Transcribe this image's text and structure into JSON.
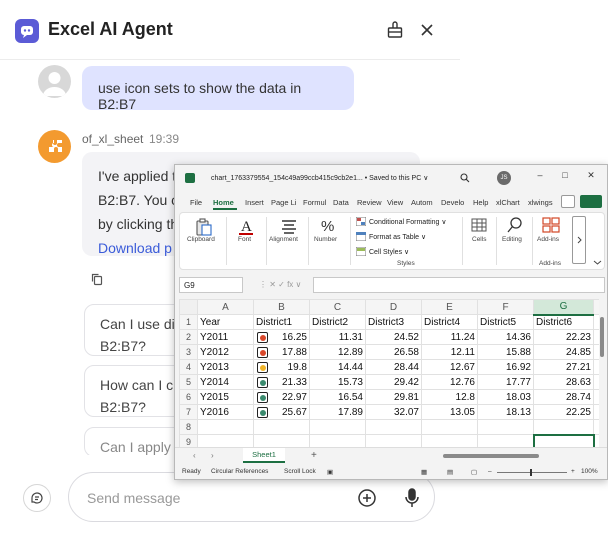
{
  "chat": {
    "header": {
      "title": "Excel AI Agent"
    },
    "user_message": "use icon sets to show the data in B2:B7",
    "bot": {
      "name": "of_xl_sheet",
      "time": "19:39",
      "line1": "I've applied t",
      "line2": "B2:B7. You ca",
      "line3": "by clicking th",
      "link": "Download p"
    },
    "suggestions": [
      {
        "line1": "Can I use dif",
        "line2": "B2:B7?"
      },
      {
        "line1": "How can I cu",
        "line2": "B2:B7?"
      },
      {
        "line1": "Can I apply"
      }
    ],
    "input": {
      "placeholder": "Send message"
    }
  },
  "excel": {
    "title": "chart_1763379554_154c49a99ccb415c9cb2e1...  •  Saved to this PC ∨",
    "user_initials": "JS",
    "window_controls": {
      "minimize": "–",
      "maximize": "□",
      "close": "✕"
    },
    "menu": [
      "File",
      "Home",
      "Insert",
      "Page Li",
      "Formul",
      "Data",
      "Review",
      "View",
      "Autom",
      "Develo",
      "Help",
      "xlChart",
      "xlwings"
    ],
    "active_menu": "Home",
    "ribbon": {
      "clipboard": "Clipboard",
      "font": "Font",
      "alignment": "Alignment",
      "number": "Number",
      "conditional_formatting": "Conditional Formatting ∨",
      "format_as_table": "Format as Table ∨",
      "cell_styles": "Cell Styles ∨",
      "styles_group": "Styles",
      "cells": "Cells",
      "editing": "Editing",
      "addins": "Add-ins",
      "addins_group": "Add-ins"
    },
    "name_box": "G9",
    "fx_controls": "⋮  ✕  ✓  fx ∨",
    "columns": [
      "A",
      "B",
      "C",
      "D",
      "E",
      "F",
      "G"
    ],
    "selected_column": "G",
    "rows": [
      {
        "n": "1",
        "cells": [
          "Year",
          "District1",
          "District2",
          "District3",
          "District4",
          "District5",
          "District6"
        ]
      },
      {
        "n": "2",
        "cells": [
          "Y2011",
          "16.25",
          "11.31",
          "24.52",
          "11.24",
          "14.36",
          "22.23"
        ],
        "icon": "#d9482b"
      },
      {
        "n": "3",
        "cells": [
          "Y2012",
          "17.88",
          "12.89",
          "26.58",
          "12.11",
          "15.88",
          "24.85"
        ],
        "icon": "#d9482b"
      },
      {
        "n": "4",
        "cells": [
          "Y2013",
          "19.8",
          "14.44",
          "28.44",
          "12.67",
          "16.92",
          "27.21"
        ],
        "icon": "#f0b429"
      },
      {
        "n": "5",
        "cells": [
          "Y2014",
          "21.33",
          "15.73",
          "29.42",
          "12.76",
          "17.77",
          "28.63"
        ],
        "icon": "#3a8a6e"
      },
      {
        "n": "6",
        "cells": [
          "Y2015",
          "22.97",
          "16.54",
          "29.81",
          "12.8",
          "18.03",
          "28.74"
        ],
        "icon": "#3a8a6e"
      },
      {
        "n": "7",
        "cells": [
          "Y2016",
          "25.67",
          "17.89",
          "32.07",
          "13.05",
          "18.13",
          "22.25"
        ],
        "icon": "#3a8a6e"
      },
      {
        "n": "8",
        "cells": [
          "",
          "",
          "",
          "",
          "",
          "",
          ""
        ]
      },
      {
        "n": "9",
        "cells": [
          "",
          "",
          "",
          "",
          "",
          "",
          ""
        ]
      }
    ],
    "sheet_tab": "Sheet1",
    "status": {
      "ready": "Ready",
      "circular": "Circular References",
      "scroll_lock": "Scroll Lock",
      "zoom": "100%"
    }
  }
}
